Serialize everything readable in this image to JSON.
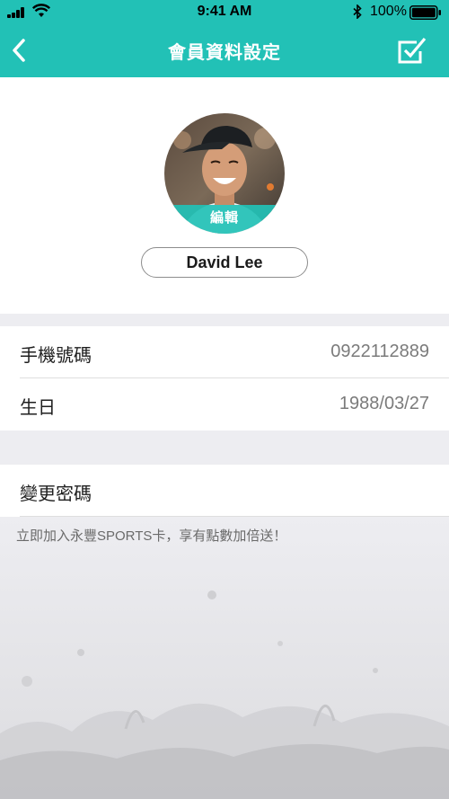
{
  "status_bar": {
    "time": "9:41 AM",
    "battery": "100%"
  },
  "nav": {
    "title": "會員資料設定",
    "back_icon": "chevron-left-icon",
    "confirm_icon": "checkbox-check-icon"
  },
  "profile": {
    "avatar_edit_label": "編輯",
    "name": "David Lee"
  },
  "info": {
    "rows": [
      {
        "label": "手機號碼",
        "value": "0922112889"
      },
      {
        "label": "生日",
        "value": "1988/03/27"
      }
    ]
  },
  "password": {
    "label": "變更密碼"
  },
  "promo": {
    "text": "立即加入永豐SPORTS卡，享有點數加倍送！"
  },
  "colors": {
    "accent": "#22c1b6",
    "background": "#ededf1"
  }
}
